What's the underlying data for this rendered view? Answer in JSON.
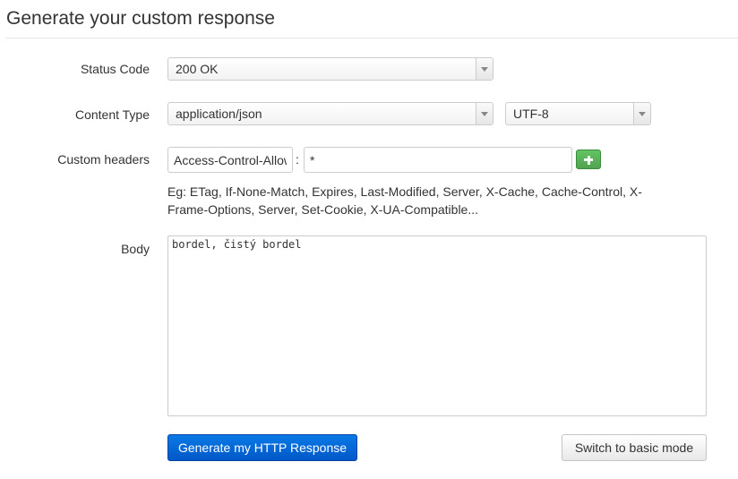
{
  "page": {
    "title": "Generate your custom response"
  },
  "status_code": {
    "label": "Status Code",
    "selected": "200 OK"
  },
  "content_type": {
    "label": "Content Type",
    "selected": "application/json",
    "charset_selected": "UTF-8"
  },
  "custom_headers": {
    "label": "Custom headers",
    "name_value": "Access-Control-Allow-Origin",
    "separator": ":",
    "value_value": "*",
    "hint": "Eg: ETag, If-None-Match, Expires, Last-Modified, Server, X-Cache, Cache-Control, X-Frame-Options, Server, Set-Cookie, X-UA-Compatible..."
  },
  "body": {
    "label": "Body",
    "value": "bordel, čistý bordel"
  },
  "actions": {
    "generate_label": "Generate my HTTP Response",
    "switch_label": "Switch to basic mode"
  },
  "icons": {
    "add_header": "plus-icon",
    "dropdown": "chevron-down-icon"
  },
  "colors": {
    "primary_button": "#0065d9",
    "add_button": "#5bb75b",
    "border": "#cccccc"
  }
}
